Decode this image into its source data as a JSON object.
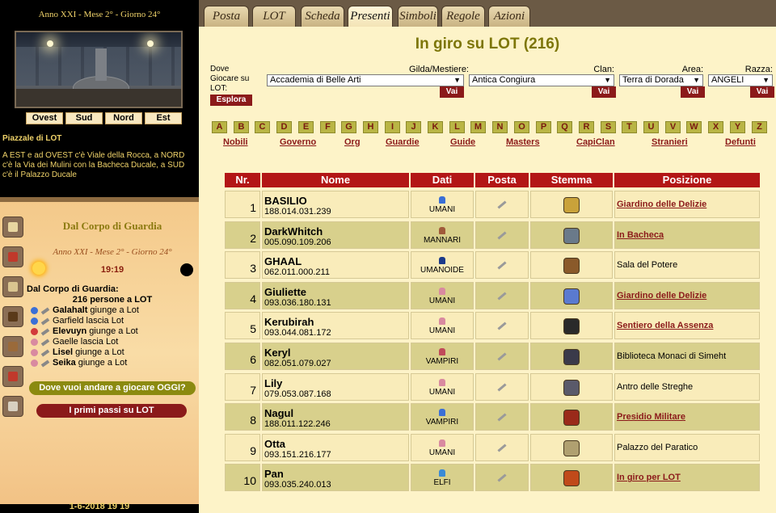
{
  "sidebar": {
    "date_top": "Anno XXI - Mese 2° - Giorno 24°",
    "directions": [
      "Ovest",
      "Sud",
      "Nord",
      "Est"
    ],
    "place_title": "Piazzale di LOT",
    "place_desc": "A EST e ad OVEST c'è Viale della Rocca, a NORD c'è la Via dei Mulini con la Bacheca Ducale, a SUD c'è il Palazzo Ducale",
    "panel_title": "Dal Corpo di Guardia",
    "panel_date": "Anno XXI - Mese 2° - Giorno 24°",
    "panel_time": "19:19",
    "guard_head": "Dal Corpo di Guardia:",
    "guard_count": "216 persone a LOT",
    "events": [
      {
        "name": "Galahalt",
        "action": "giunge a Lot",
        "icon_color": "#3a6fd6",
        "bold": true
      },
      {
        "name": "Garfield",
        "action": "lascia Lot",
        "icon_color": "#3a6fd6",
        "bold": false
      },
      {
        "name": "Elevuyn",
        "action": "giunge a Lot",
        "icon_color": "#d23a3a",
        "bold": true
      },
      {
        "name": "Gaelle",
        "action": "lascia Lot",
        "icon_color": "#d98aa0",
        "bold": false
      },
      {
        "name": "Lisel",
        "action": "giunge a Lot",
        "icon_color": "#d98aa0",
        "bold": true
      },
      {
        "name": "Seika",
        "action": "giunge a Lot",
        "icon_color": "#d98aa0",
        "bold": true
      }
    ],
    "question_button": "Dove vuoi andare a giocare OGGI?",
    "first_steps_button": "I primi passi su LOT",
    "footer_date": "1-6-2018 19 19"
  },
  "tabs": [
    "Posta",
    "LOT",
    "Scheda",
    "Presenti",
    "Simboli",
    "Regole",
    "Azioni"
  ],
  "active_tab": "Presenti",
  "page_title": "In giro su LOT (216)",
  "filters": {
    "dove_label": "Dove Giocare su LOT:",
    "esplora": "Esplora",
    "vai": "Vai",
    "gilda_label": "Gilda/Mestiere:",
    "gilda_value": "Accademia di Belle Arti",
    "clan_label": "Clan:",
    "clan_value": "Antica Congiura",
    "area_label": "Area:",
    "area_value": "Terra di Dorada",
    "razza_label": "Razza:",
    "razza_value": "ANGELI"
  },
  "letters": [
    "A",
    "B",
    "C",
    "D",
    "E",
    "F",
    "G",
    "H",
    "I",
    "J",
    "K",
    "L",
    "M",
    "N",
    "O",
    "P",
    "Q",
    "R",
    "S",
    "T",
    "U",
    "V",
    "W",
    "X",
    "Y",
    "Z"
  ],
  "categories": [
    "Nobili",
    "Governo",
    "Org",
    "Guardie",
    "Guide",
    "Masters",
    "CapiClan",
    "Stranieri",
    "Defunti"
  ],
  "table": {
    "headers": {
      "nr": "Nr.",
      "nome": "Nome",
      "dati": "Dati",
      "posta": "Posta",
      "stemma": "Stemma",
      "posizione": "Posizione"
    },
    "rows": [
      {
        "nr": "1",
        "name": "BASILIO",
        "ip": "188.014.031.239",
        "race": "UMANI",
        "race_color": "#3a6fd6",
        "crest_color": "#c9a23a",
        "position": "Giardino delle Delizie",
        "link": true
      },
      {
        "nr": "2",
        "name": "DarkWhitch",
        "ip": "005.090.109.206",
        "race": "MANNARI",
        "race_color": "#a05a3a",
        "crest_color": "#6a7a8a",
        "position": "In Bacheca",
        "link": true
      },
      {
        "nr": "3",
        "name": "GHAAL",
        "ip": "062.011.000.211",
        "race": "UMANOIDE",
        "race_color": "#1a3a8a",
        "crest_color": "#8a5a2a",
        "position": "Sala del Potere",
        "link": false
      },
      {
        "nr": "4",
        "name": "Giuliette",
        "ip": "093.036.180.131",
        "race": "UMANI",
        "race_color": "#d98aa0",
        "crest_color": "#5a7ad0",
        "position": "Giardino delle Delizie",
        "link": true
      },
      {
        "nr": "5",
        "name": "Kerubirah",
        "ip": "093.044.081.172",
        "race": "UMANI",
        "race_color": "#d98aa0",
        "crest_color": "#2a2a2a",
        "position": "Sentiero della Assenza",
        "link": true
      },
      {
        "nr": "6",
        "name": "Keryl",
        "ip": "082.051.079.027",
        "race": "VAMPIRI",
        "race_color": "#c04a5a",
        "crest_color": "#3a3a4a",
        "position": "Biblioteca Monaci di Simeht",
        "link": false
      },
      {
        "nr": "7",
        "name": "Lily",
        "ip": "079.053.087.168",
        "race": "UMANI",
        "race_color": "#d98aa0",
        "crest_color": "#5a5a6a",
        "position": "Antro delle Streghe",
        "link": false
      },
      {
        "nr": "8",
        "name": "Nagul",
        "ip": "188.011.122.246",
        "race": "VAMPIRI",
        "race_color": "#3a6fd6",
        "crest_color": "#9a2a1a",
        "position": "Presidio Militare",
        "link": true
      },
      {
        "nr": "9",
        "name": "Otta",
        "ip": "093.151.216.177",
        "race": "UMANI",
        "race_color": "#d98aa0",
        "crest_color": "#b0a070",
        "position": "Palazzo del Paratico",
        "link": false
      },
      {
        "nr": "10",
        "name": "Pan",
        "ip": "093.035.240.013",
        "race": "ELFI",
        "race_color": "#3a8ad6",
        "crest_color": "#c04a1a",
        "position": "In giro per LOT",
        "link": true
      }
    ]
  }
}
